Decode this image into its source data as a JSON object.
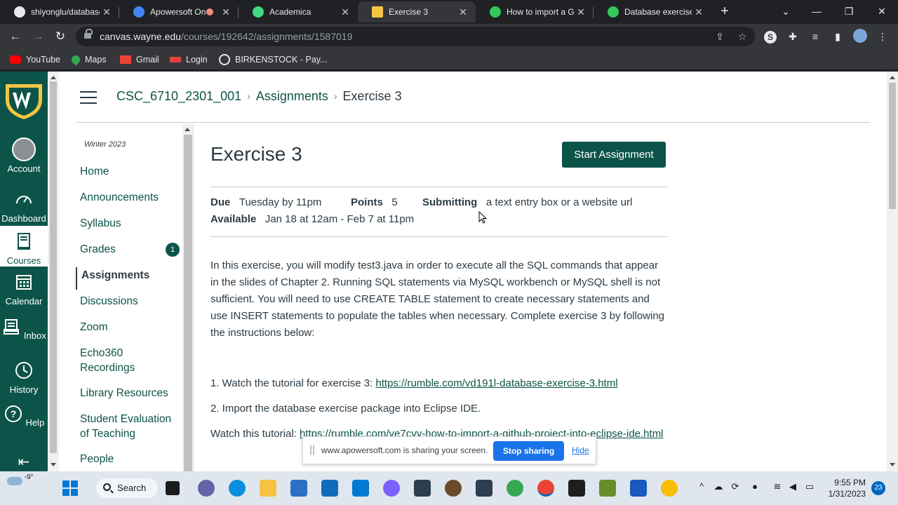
{
  "browser": {
    "tabs": [
      {
        "title": "shiyonglu/database",
        "favicon_color": "#e8eaed"
      },
      {
        "title": "Apowersoft On",
        "favicon_color": "#4285f4"
      },
      {
        "title": "Academica",
        "favicon_color": "#3ddc84"
      },
      {
        "title": "Exercise 3",
        "favicon_color": "#f4c542"
      },
      {
        "title": "How to import a Gi",
        "favicon_color": "#34c759"
      },
      {
        "title": "Database exercise",
        "favicon_color": "#34c759"
      }
    ],
    "new_tab": "+",
    "url_host": "canvas.wayne.edu",
    "url_path": "/courses/192642/assignments/1587019",
    "bookmarks": [
      {
        "label": "YouTube",
        "color": "#ff0000"
      },
      {
        "label": "Maps",
        "color": "#34a853"
      },
      {
        "label": "Gmail",
        "color": "#ea4335"
      },
      {
        "label": "Login",
        "color": "#e2453c"
      },
      {
        "label": "BIRKENSTOCK - Pay...",
        "color": "#e8eaed"
      }
    ]
  },
  "global_nav": {
    "items": [
      {
        "label": "Account"
      },
      {
        "label": "Dashboard"
      },
      {
        "label": "Courses"
      },
      {
        "label": "Calendar"
      },
      {
        "label": "Inbox"
      },
      {
        "label": "History"
      },
      {
        "label": "Help"
      }
    ],
    "accent": "#0c5449"
  },
  "breadcrumbs": [
    "CSC_6710_2301_001",
    "Assignments",
    "Exercise 3"
  ],
  "course_nav": {
    "term": "Winter 2023",
    "items": [
      {
        "label": "Home"
      },
      {
        "label": "Announcements"
      },
      {
        "label": "Syllabus"
      },
      {
        "label": "Grades",
        "badge": "1"
      },
      {
        "label": "Assignments"
      },
      {
        "label": "Discussions"
      },
      {
        "label": "Zoom"
      },
      {
        "label": "Echo360 Recordings"
      },
      {
        "label": "Library Resources"
      },
      {
        "label": "Student Evaluation of Teaching"
      },
      {
        "label": "People"
      }
    ]
  },
  "assignment": {
    "title": "Exercise 3",
    "start_button": "Start Assignment",
    "due_label": "Due",
    "due_value": "Tuesday by 11pm",
    "points_label": "Points",
    "points_value": "5",
    "submitting_label": "Submitting",
    "submitting_value": "a text entry box or a website url",
    "available_label": "Available",
    "available_value": "Jan 18 at 12am - Feb 7 at 11pm",
    "intro": "In this exercise, you will modify test3.java in order to execute all the SQL commands that appear in the slides of Chapter 2. Running SQL statements via MySQL workbench or MySQL shell is not sufficient. You will need to use CREATE TABLE statement to create necessary statements and use INSERT statements to populate the tables when necessary.  Complete exercise 3 by following the instructions below:",
    "step1_text": "1. Watch the tutorial for exercise 3: ",
    "step1_link": "https://rumble.com/vd191l-database-exercise-3.html",
    "step2_text": "2.  Import the database exercise package into Eclipse IDE.",
    "step3_text": "Watch this tutorial: ",
    "step3_link": "https://rumble.com/ve7cvy-how-to-import-a-github-project-into-eclipse-ide.html"
  },
  "share_banner": {
    "message": "www.apowersoft.com is sharing your screen.",
    "stop_label": "Stop sharing",
    "hide_label": "Hide"
  },
  "taskbar": {
    "weather": "-9°",
    "search_label": "Search",
    "time": "9:55 PM",
    "date": "1/31/2023",
    "notifications": "23"
  }
}
